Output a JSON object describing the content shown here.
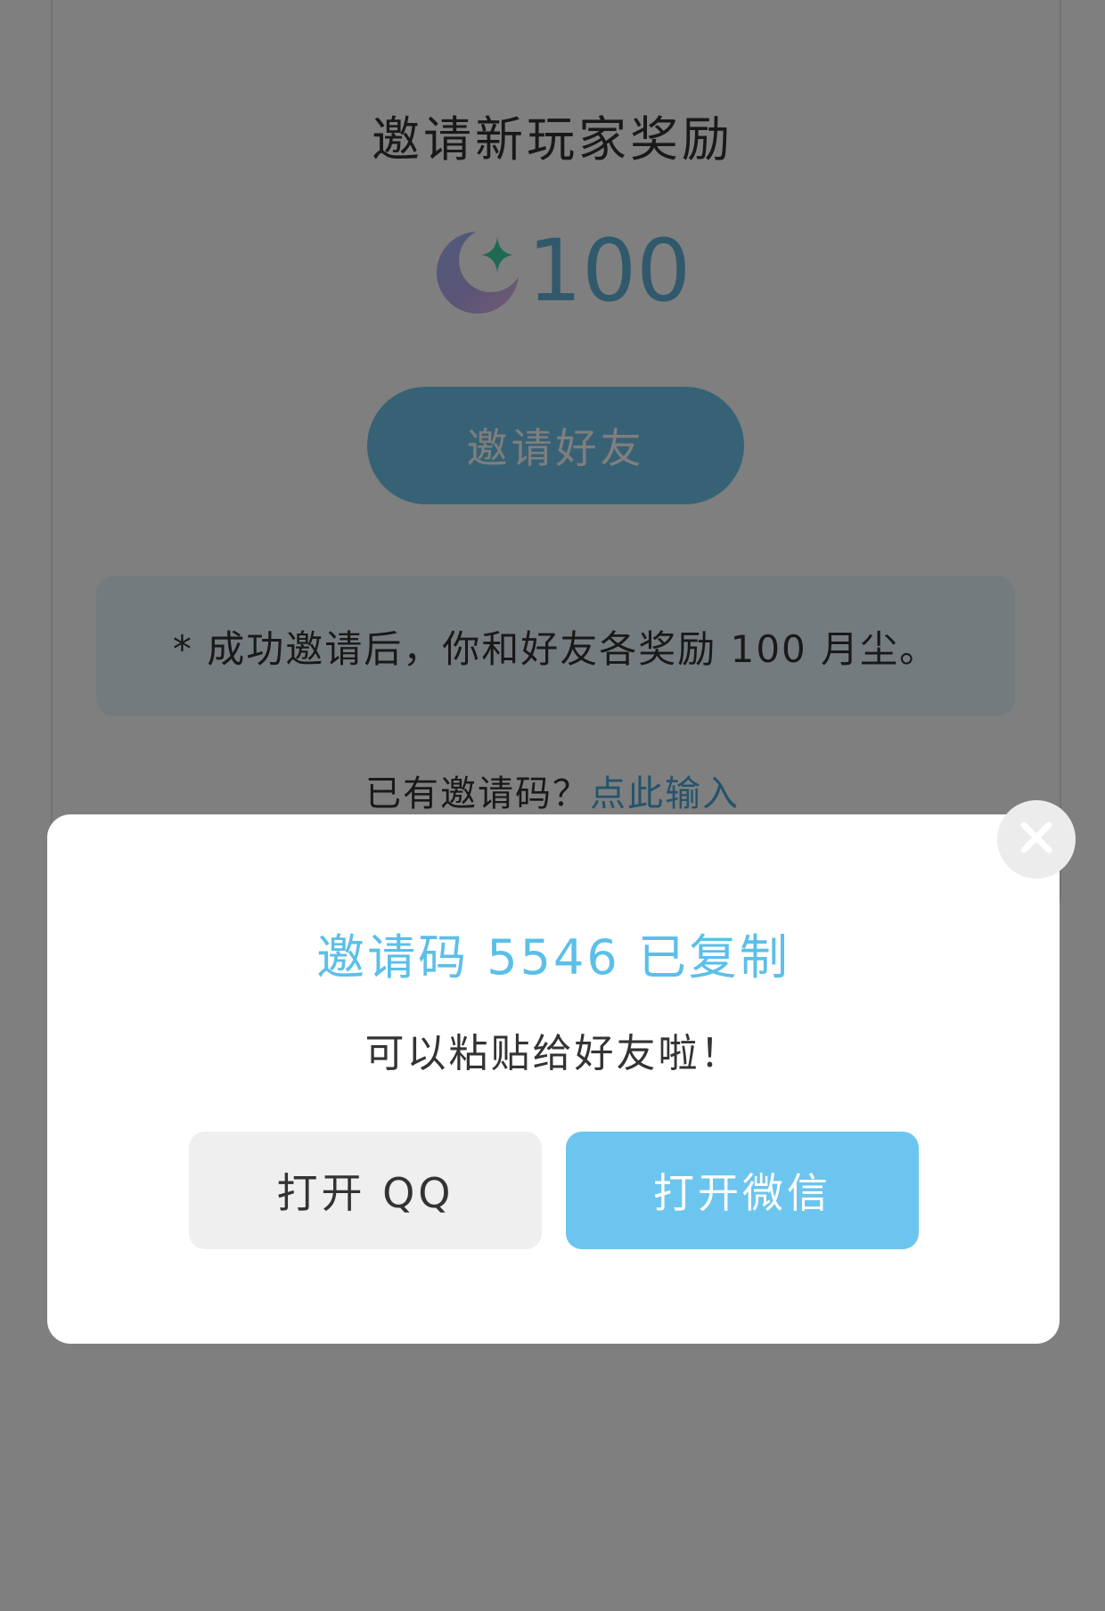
{
  "invite_page": {
    "title": "邀请新玩家奖励",
    "reward_icon": "moon-star-icon",
    "reward_amount": "100",
    "invite_button": "邀请好友",
    "notice": "* 成功邀请后，你和好友各奖励 100 月尘。",
    "has_code_prefix": "已有邀请码？",
    "has_code_link": "点此输入"
  },
  "modal": {
    "title": "邀请码 5546 已复制",
    "subtitle": "可以粘贴给好友啦！",
    "close_icon": "close-icon",
    "buttons": {
      "qq": "打开 QQ",
      "wechat": "打开微信"
    }
  },
  "colors": {
    "accent": "#6ec5ec",
    "link": "#49a9d6",
    "modal_title": "#5bbfe9",
    "overlay": "rgba(0,0,0,0.5)"
  }
}
